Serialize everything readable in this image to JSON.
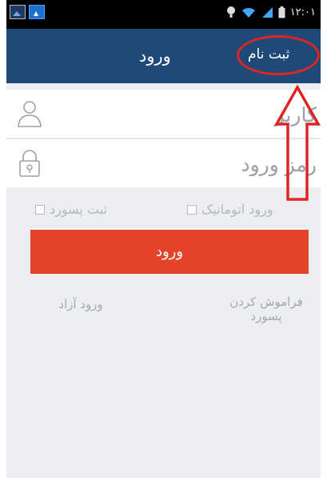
{
  "status_bar": {
    "time": "۱۲:۰۱",
    "icons": [
      "image-icon",
      "app-icon",
      "alarm-icon",
      "wifi-icon",
      "signal-icon",
      "battery-icon"
    ]
  },
  "app_bar": {
    "title": "ورود",
    "register_label": "ثبت نام"
  },
  "form": {
    "username_placeholder": "کاربر",
    "password_placeholder": "رمز ورود",
    "auto_login_label": "ورود اتوماتیک",
    "save_password_label": "ثبت پسورد",
    "auto_login_checked": false,
    "save_password_checked": false,
    "login_button_label": "ورود"
  },
  "links": {
    "forgot_password_label": "فراموش کردن پسورد",
    "guest_login_label": "ورود آزاد"
  },
  "annotation": {
    "color": "#e02424"
  },
  "colors": {
    "app_bar": "#1f4a77",
    "login_button": "#e5432a",
    "background": "#eceef1"
  }
}
